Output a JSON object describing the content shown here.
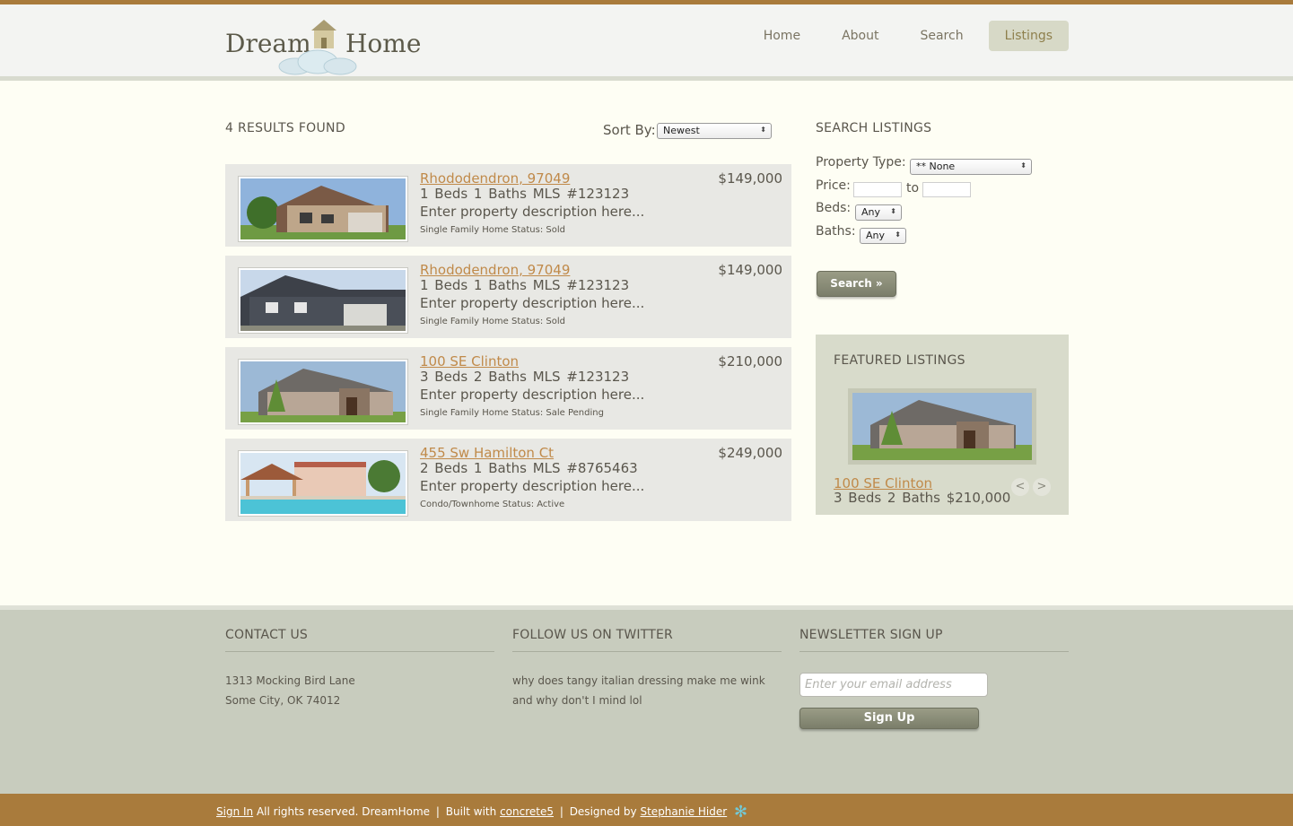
{
  "header": {
    "logo_left": "Dream",
    "logo_right": "Home",
    "nav": [
      "Home",
      "About",
      "Search",
      "Listings"
    ],
    "active_nav": "Listings"
  },
  "results": {
    "title": "4 RESULTS FOUND",
    "sort_label": "Sort By:",
    "sort_value": "Newest"
  },
  "listings": [
    {
      "title": "Rhododendron, 97049",
      "facts": "1 Beds  1 Baths  MLS #123123",
      "desc": "Enter property description here...",
      "meta": "Single Family Home   Status: Sold",
      "price": "$149,000"
    },
    {
      "title": "Rhododendron, 97049",
      "facts": "1 Beds  1 Baths  MLS #123123",
      "desc": "Enter property description here...",
      "meta": "Single Family Home   Status: Sold",
      "price": "$149,000"
    },
    {
      "title": "100 SE Clinton",
      "facts": "3 Beds  2 Baths  MLS #123123",
      "desc": "Enter property description here...",
      "meta": "Single Family Home   Status: Sale Pending",
      "price": "$210,000"
    },
    {
      "title": "455 Sw Hamilton Ct",
      "facts": "2 Beds  1 Baths  MLS #8765463",
      "desc": "Enter property description here...",
      "meta": "Condo/Townhome   Status: Active",
      "price": "$249,000"
    }
  ],
  "search": {
    "title": "SEARCH LISTINGS",
    "property_type_label": "Property Type:",
    "property_type_value": "** None",
    "price_label": "Price:",
    "price_to": "to",
    "beds_label": "Beds:",
    "beds_value": "Any",
    "baths_label": "Baths:",
    "baths_value": "Any",
    "button": "Search »"
  },
  "featured": {
    "title": "FEATURED LISTINGS",
    "link": "100 SE Clinton",
    "facts": "3 Beds  2 Baths  $210,000",
    "prev": "<",
    "next": ">"
  },
  "footer": {
    "contact_title": "CONTACT US",
    "address_line1": "1313 Mocking Bird Lane",
    "address_line2": "Some City, OK 74012",
    "twitter_title": "FOLLOW US ON TWITTER",
    "tweet": "why does tangy italian dressing make me wink and why don't I mind lol",
    "newsletter_title": "NEWSLETTER SIGN UP",
    "email_placeholder": "Enter your email address",
    "signup_button": "Sign Up"
  },
  "bottombar": {
    "sign_in": "Sign In",
    "rights": "All rights reserved. DreamHome",
    "built_with": "Built with",
    "cms": "concrete5",
    "designed_by": "Designed by",
    "designer": "Stephanie Hider"
  },
  "colors": {
    "accent_brown": "#a97b3c",
    "link": "#c08a4a",
    "footer_bg": "#c8ccbe",
    "page_bg": "#fefef4"
  }
}
